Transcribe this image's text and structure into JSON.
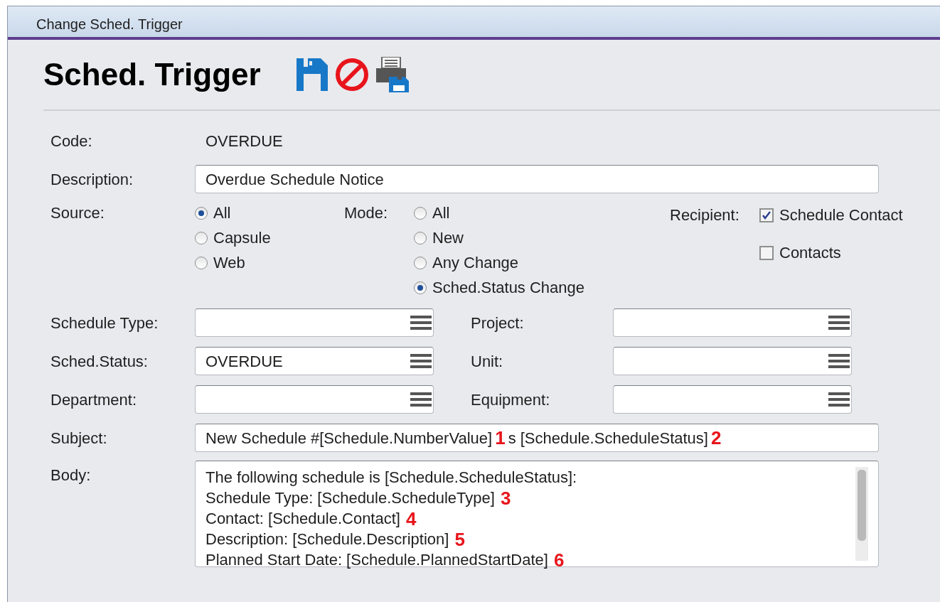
{
  "window": {
    "title": "Change Sched. Trigger"
  },
  "header": {
    "title": "Sched. Trigger"
  },
  "form": {
    "code": {
      "label": "Code:",
      "value": "OVERDUE"
    },
    "description": {
      "label": "Description:",
      "value": "Overdue Schedule Notice"
    },
    "source": {
      "label": "Source:",
      "options": [
        {
          "label": "All",
          "selected": true
        },
        {
          "label": "Capsule",
          "selected": false
        },
        {
          "label": "Web",
          "selected": false
        }
      ]
    },
    "mode": {
      "label": "Mode:",
      "options": [
        {
          "label": "All",
          "selected": false
        },
        {
          "label": "New",
          "selected": false
        },
        {
          "label": "Any Change",
          "selected": false
        },
        {
          "label": "Sched.Status Change",
          "selected": true
        }
      ]
    },
    "recipient": {
      "label": "Recipient:",
      "options": [
        {
          "label": "Schedule Contact",
          "checked": true
        },
        {
          "label": "Contacts",
          "checked": false
        }
      ]
    },
    "lookups": [
      {
        "left": {
          "label": "Schedule Type:"
        },
        "right": {
          "label": "Project:"
        }
      },
      {
        "left": {
          "label": "Sched.Status:",
          "value": "OVERDUE"
        },
        "right": {
          "label": "Unit:"
        }
      },
      {
        "left": {
          "label": "Department:"
        },
        "right": {
          "label": "Equipment:"
        }
      }
    ],
    "subject": {
      "label": "Subject:",
      "parts": [
        {
          "kind": "text",
          "text": "New Schedule #[Schedule.NumberValue]"
        },
        {
          "kind": "marker",
          "text": "1"
        },
        {
          "kind": "text",
          "text": "s [Schedule.ScheduleStatus]"
        },
        {
          "kind": "marker",
          "text": "2"
        }
      ]
    },
    "body": {
      "label": "Body:",
      "lines": [
        {
          "text": "The following schedule is [Schedule.ScheduleStatus]:"
        },
        {
          "text": "Schedule Type: [Schedule.ScheduleType]",
          "marker": "3"
        },
        {
          "text": "Contact: [Schedule.Contact]",
          "marker": "4"
        },
        {
          "text": "Description: [Schedule.Description]",
          "marker": "5"
        },
        {
          "text": "Planned Start Date: [Schedule.PlannedStartDate]",
          "marker": "6"
        }
      ]
    }
  }
}
